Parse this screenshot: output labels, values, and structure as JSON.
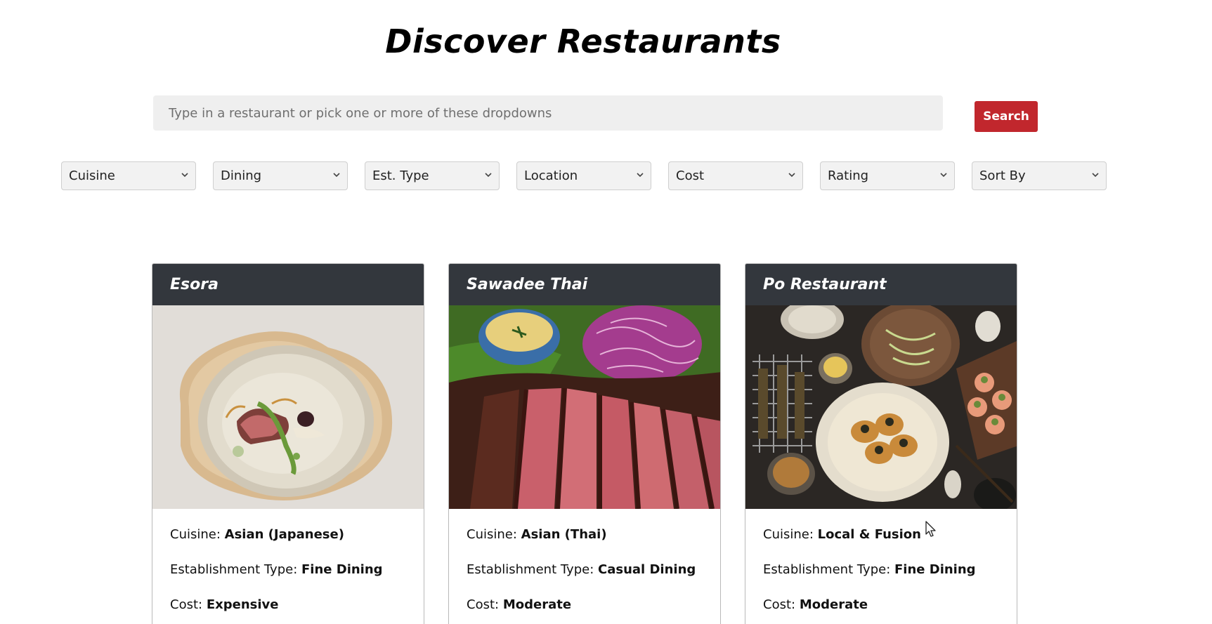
{
  "page": {
    "title": "Discover Restaurants"
  },
  "search": {
    "placeholder": "Type in a restaurant or pick one or more of these dropdowns",
    "button_label": "Search"
  },
  "filters": [
    {
      "label": "Cuisine"
    },
    {
      "label": "Dining"
    },
    {
      "label": "Est. Type"
    },
    {
      "label": "Location"
    },
    {
      "label": "Cost"
    },
    {
      "label": "Rating"
    },
    {
      "label": "Sort By"
    }
  ],
  "cards": [
    {
      "name": "Esora",
      "image_icon": "plated-dish-photo",
      "cuisine_label": "Cuisine:",
      "cuisine": "Asian (Japanese)",
      "type_label": "Establishment Type:",
      "type": "Fine Dining",
      "cost_label": "Cost:",
      "cost": "Expensive"
    },
    {
      "name": "Sawadee Thai",
      "image_icon": "grilled-steak-photo",
      "cuisine_label": "Cuisine:",
      "cuisine": "Asian (Thai)",
      "type_label": "Establishment Type:",
      "type": "Casual Dining",
      "cost_label": "Cost:",
      "cost": "Moderate"
    },
    {
      "name": "Po Restaurant",
      "image_icon": "food-spread-photo",
      "cuisine_label": "Cuisine:",
      "cuisine": "Local & Fusion",
      "type_label": "Establishment Type:",
      "type": "Fine Dining",
      "cost_label": "Cost:",
      "cost": "Moderate"
    }
  ],
  "colors": {
    "accent": "#c1272d",
    "card_header": "#33373d",
    "input_bg": "#efefef"
  }
}
